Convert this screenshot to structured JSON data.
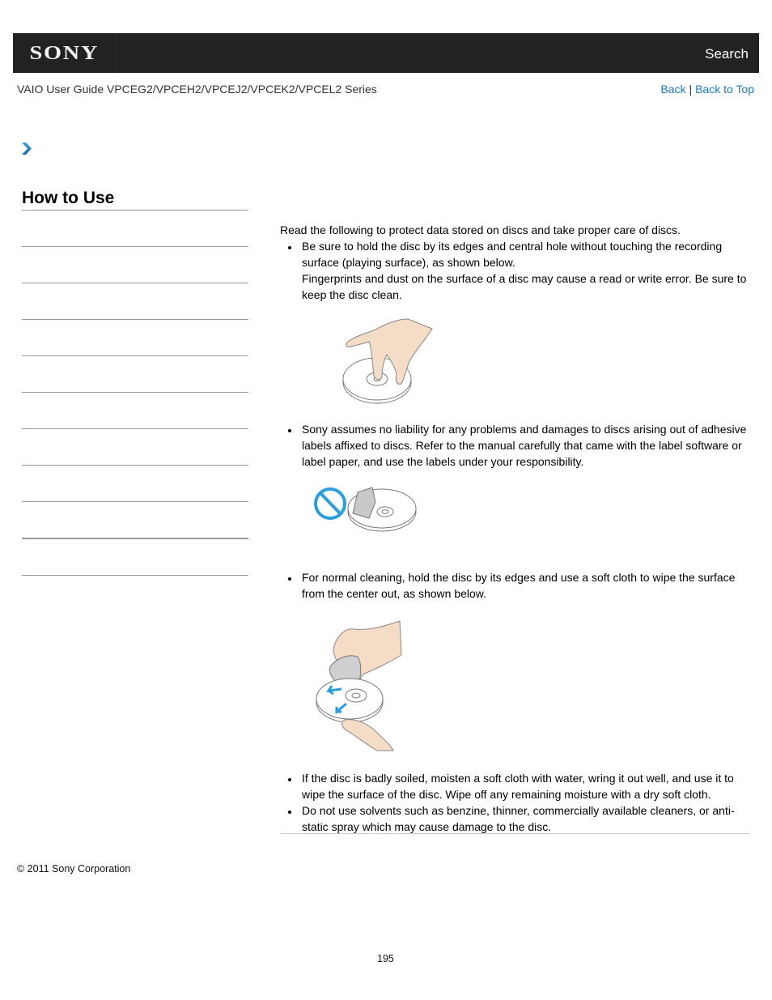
{
  "header": {
    "logo": "SONY",
    "search_label": "Search"
  },
  "subheader": {
    "guide_title": "VAIO User Guide VPCEG2/VPCEH2/VPCEJ2/VPCEK2/VPCEL2 Series",
    "back_label": "Back",
    "separator": "|",
    "back_to_top_label": "Back to Top"
  },
  "breadcrumb": {
    "icon": "chevron-right-icon"
  },
  "sidebar": {
    "title": "How to Use",
    "items": [
      {
        "label": ""
      },
      {
        "label": ""
      },
      {
        "label": ""
      },
      {
        "label": ""
      },
      {
        "label": ""
      },
      {
        "label": ""
      },
      {
        "label": ""
      },
      {
        "label": ""
      },
      {
        "label": ""
      },
      {
        "label": ""
      }
    ]
  },
  "content": {
    "intro": "Read the following to protect data stored on discs and take proper care of discs.",
    "bullets": [
      {
        "text": "Be sure to hold the disc by its edges and central hole without touching the recording surface (playing surface), as shown below.",
        "note": "Fingerprints and dust on the surface of a disc may cause a read or write error. Be sure to keep the disc clean.",
        "figure": "hand-holding-disc-illustration"
      },
      {
        "text": "Sony assumes no liability for any problems and damages to discs arising out of adhesive labels affixed to discs. Refer to the manual carefully that came with the label software or label paper, and use the labels under your responsibility.",
        "figure": "no-adhesive-label-illustration"
      },
      {
        "text": "For normal cleaning, hold the disc by its edges and use a soft cloth to wipe the surface from the center out, as shown below.",
        "figure": "wiping-disc-illustration"
      },
      {
        "text": "If the disc is badly soiled, moisten a soft cloth with water, wring it out well, and use it to wipe the surface of the disc. Wipe off any remaining moisture with a dry soft cloth."
      },
      {
        "text": "Do not use solvents such as benzine, thinner, commercially available cleaners, or anti-static spray which may cause damage to the disc."
      }
    ]
  },
  "footer": {
    "copyright": "© 2011 Sony Corporation",
    "page_number": "195"
  },
  "colors": {
    "header_bg": "#222222",
    "link": "#1a7bc4",
    "prohibition": "#2a9fe0",
    "divider": "#999999"
  }
}
